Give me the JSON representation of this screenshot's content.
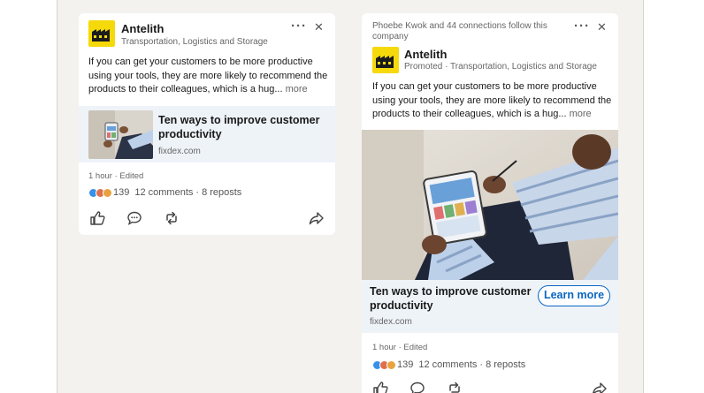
{
  "ad_small": {
    "company": "Antelith",
    "subtitle": "Transportation, Logistics and Storage",
    "body": "If you can get your customers to be more productive using your tools, they are more likely to recommend the products to their colleagues, which is a hug...",
    "more": "more",
    "link_title": "Ten ways to improve customer productivity",
    "link_domain": "fixdex.com",
    "time": "1 hour · Edited",
    "reaction_count": "139",
    "comments": "12 comments",
    "separator": "·",
    "reposts": "8 reposts"
  },
  "ad_large": {
    "social_proof": "Phoebe Kwok and 44 connections follow this company",
    "company": "Antelith",
    "subtitle": "Promoted · Transportation, Logistics and Storage",
    "body": "If you can get your customers to be more productive using your tools, they are more likely to recommend the products to their colleagues, which is a hug...",
    "more": "more",
    "link_title": "Ten ways to improve customer productivity",
    "link_domain": "fixdex.com",
    "cta": "Learn more",
    "time": "1 hour · Edited",
    "reaction_count": "139",
    "comments": "12 comments",
    "separator": "·",
    "reposts": "8 reposts"
  },
  "controls": {
    "more_glyph": "···",
    "close_glyph": "✕"
  },
  "icons": [
    "menu-dots-icon",
    "close-icon",
    "like-icon",
    "comment-icon",
    "repost-icon",
    "share-icon",
    "company-logo-icon"
  ],
  "colors": {
    "accent": "#0a66c2",
    "logo_yellow": "#f5d90a",
    "link_strip": "#eef3f8",
    "panel_bg": "#f3f2ef"
  }
}
